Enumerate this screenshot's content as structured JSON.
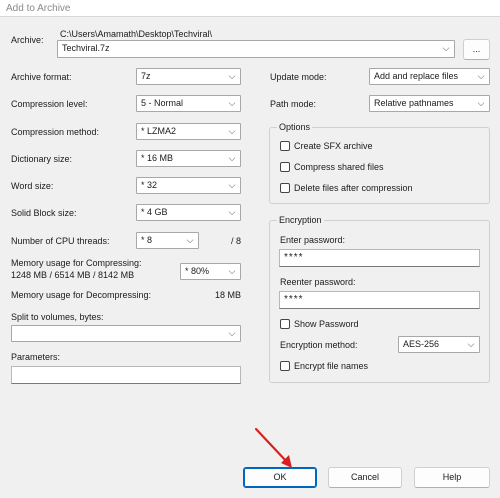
{
  "window": {
    "title": "Add to Archive"
  },
  "archive": {
    "label": "Archive:",
    "path": "C:\\Users\\Amamath\\Desktop\\Techviral\\",
    "filename": "Techviral.7z",
    "browse_label": "..."
  },
  "left": {
    "format_label": "Archive format:",
    "format_value": "7z",
    "level_label": "Compression level:",
    "level_value": "5 - Normal",
    "method_label": "Compression method:",
    "method_value": "* LZMA2",
    "dict_label": "Dictionary size:",
    "dict_value": "* 16 MB",
    "word_label": "Word size:",
    "word_value": "* 32",
    "solid_label": "Solid Block size:",
    "solid_value": "* 4 GB",
    "threads_label": "Number of CPU threads:",
    "threads_value": "* 8",
    "threads_max": "/ 8",
    "mem_comp_label": "Memory usage for Compressing:",
    "mem_comp_detail": "1248 MB / 6514 MB / 8142 MB",
    "mem_comp_value": "* 80%",
    "mem_decomp_label": "Memory usage for Decompressing:",
    "mem_decomp_value": "18 MB",
    "split_label": "Split to volumes, bytes:",
    "split_value": "",
    "params_label": "Parameters:",
    "params_value": ""
  },
  "right": {
    "update_label": "Update mode:",
    "update_value": "Add and replace files",
    "path_label": "Path mode:",
    "path_value": "Relative pathnames",
    "options": {
      "title": "Options",
      "sfx": "Create SFX archive",
      "shared": "Compress shared files",
      "delete": "Delete files after compression"
    },
    "encryption": {
      "title": "Encryption",
      "enter_label": "Enter password:",
      "enter_value": "****",
      "reenter_label": "Reenter password:",
      "reenter_value": "****",
      "show_label": "Show Password",
      "method_label": "Encryption method:",
      "method_value": "AES-256",
      "names_label": "Encrypt file names"
    }
  },
  "buttons": {
    "ok": "OK",
    "cancel": "Cancel",
    "help": "Help"
  },
  "icons": {
    "dropdown": "chevron-down-icon",
    "annotation": "red-arrow-icon"
  },
  "colors": {
    "accent": "#0067c0",
    "annotation": "#d9201f"
  }
}
